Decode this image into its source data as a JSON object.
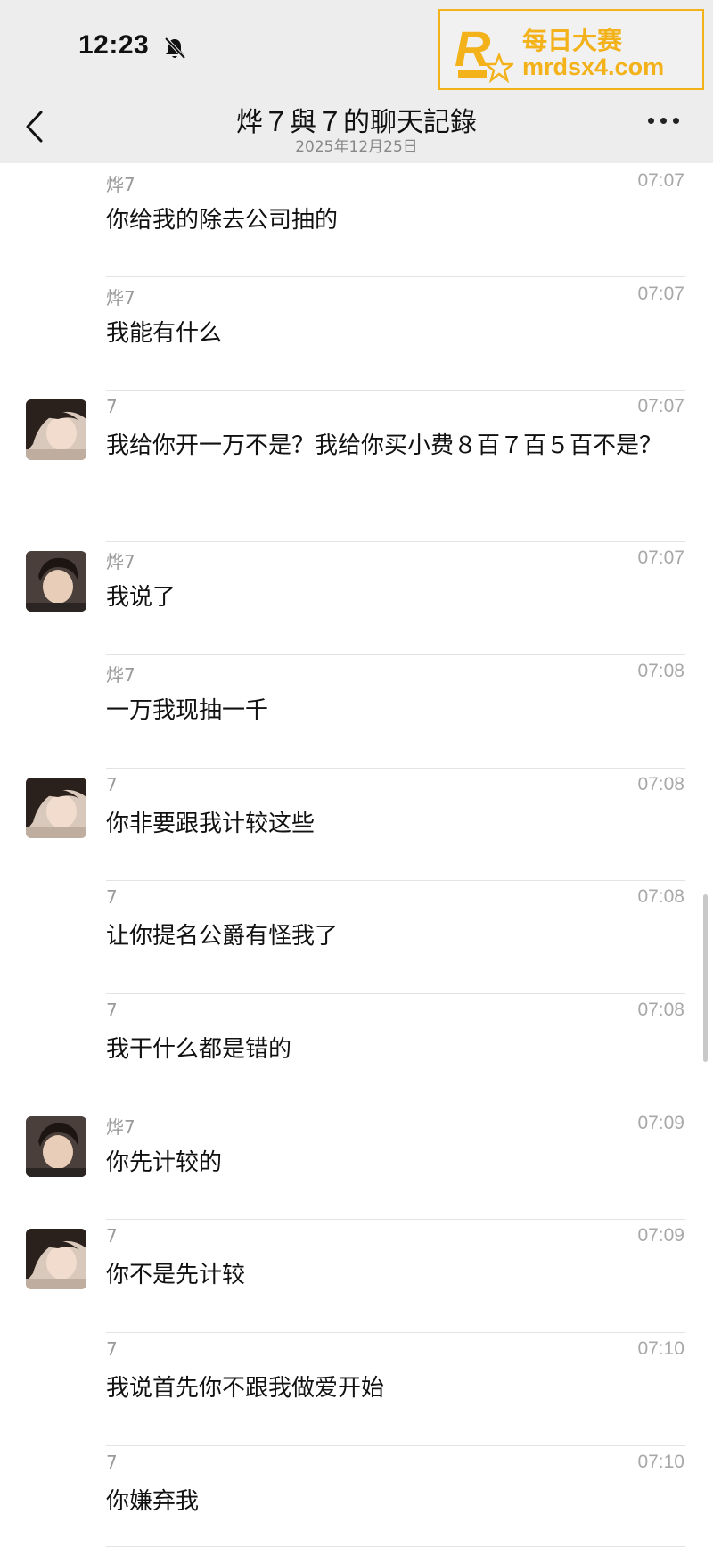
{
  "status_bar": {
    "time": "12:23"
  },
  "watermark": {
    "title": "每日大赛",
    "url": "mrdsx4.com",
    "badge": "R",
    "color": "#f3b21a"
  },
  "nav": {
    "title": "烨７與７的聊天記錄",
    "date": "2025年12月25日",
    "back_icon": "chevron-left-icon",
    "more_icon": "more-dots-icon"
  },
  "messages": [
    {
      "sender": "烨7",
      "time": "07:07",
      "text": "你给我的除去公司抽的",
      "avatar": "none"
    },
    {
      "sender": "烨7",
      "time": "07:07",
      "text": "我能有什么",
      "avatar": "none"
    },
    {
      "sender": "7",
      "time": "07:07",
      "text": "我给你开一万不是？我给你买小费８百７百５百不是？",
      "avatar": "woman"
    },
    {
      "sender": "烨7",
      "time": "07:07",
      "text": "我说了",
      "avatar": "man"
    },
    {
      "sender": "烨7",
      "time": "07:08",
      "text": "一万我现抽一千",
      "avatar": "none"
    },
    {
      "sender": "7",
      "time": "07:08",
      "text": "你非要跟我计较这些",
      "avatar": "woman"
    },
    {
      "sender": "7",
      "time": "07:08",
      "text": "让你提名公爵有怪我了",
      "avatar": "none"
    },
    {
      "sender": "7",
      "time": "07:08",
      "text": "我干什么都是错的",
      "avatar": "none"
    },
    {
      "sender": "烨7",
      "time": "07:09",
      "text": "你先计较的",
      "avatar": "man"
    },
    {
      "sender": "7",
      "time": "07:09",
      "text": "你不是先计较",
      "avatar": "woman"
    },
    {
      "sender": "7",
      "time": "07:10",
      "text": "我说首先你不跟我做爱开始",
      "avatar": "none"
    },
    {
      "sender": "7",
      "time": "07:10",
      "text": "你嫌弃我",
      "avatar": "none"
    }
  ]
}
